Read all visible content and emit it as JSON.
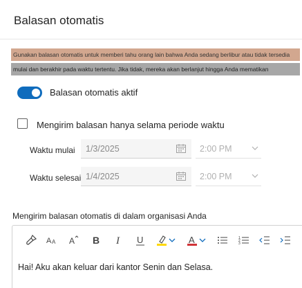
{
  "dialog": {
    "title": "Balasan otomatis"
  },
  "info": {
    "line1": "Gunakan balasan otomatis untuk memberi tahu orang lain bahwa Anda sedang berlibur atau tidak tersedia",
    "line2": "mulai dan berakhir pada waktu tertentu. Jika tidak, mereka akan berlanjut hingga Anda mematikan"
  },
  "auto_reply": {
    "label": "Balasan otomatis aktif",
    "enabled": true
  },
  "time_period": {
    "label": "Mengirim balasan hanya selama periode waktu",
    "checked": false
  },
  "start": {
    "label": "Waktu mulai",
    "date": "1/3/2025",
    "time": "2:00 PM"
  },
  "end": {
    "label": "Waktu selesai",
    "date": "1/4/2025",
    "time": "2:00 PM"
  },
  "inside_org": {
    "label": "Mengirim balasan otomatis di dalam organisasi Anda",
    "message": "Hai! Aku akan keluar dari kantor Senin dan Selasa."
  },
  "toolbar": {
    "icons": [
      "format-painter-icon",
      "font-size-icon",
      "grow-font-icon",
      "bold-icon",
      "italic-icon",
      "underline-icon",
      "highlight-icon",
      "font-color-icon",
      "bullets-icon",
      "numbering-icon",
      "decrease-indent-icon",
      "increase-indent-icon"
    ],
    "accent": "#0f6cbd",
    "highlight_color": "#ffd800",
    "font_color": "#d13438"
  }
}
